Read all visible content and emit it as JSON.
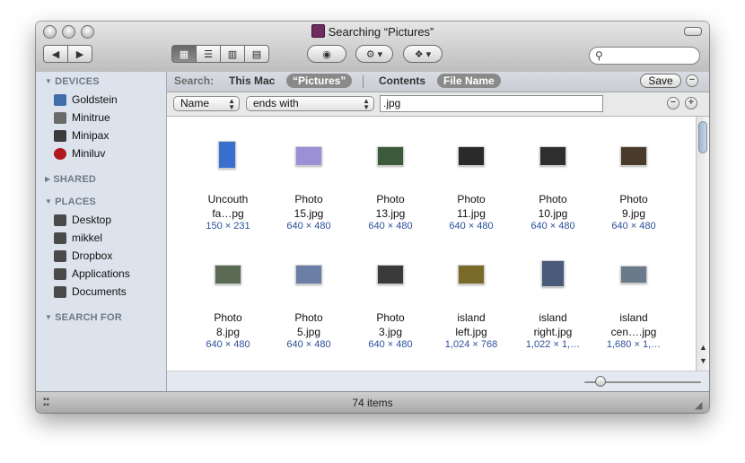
{
  "window": {
    "title": "Searching “Pictures”"
  },
  "toolbar": {
    "back_icon": "◀",
    "forward_icon": "▶",
    "view_icons": [
      "▦",
      "☰",
      "▥",
      "▤"
    ],
    "quicklook_icon": "◉",
    "action_icon": "⚙ ▾",
    "dropbox_icon": "❖ ▾",
    "search_placeholder": "",
    "search_icon": "⚲"
  },
  "sidebar": {
    "sections": {
      "devices": "DEVICES",
      "shared": "SHARED",
      "places": "PLACES",
      "search_for": "SEARCH FOR"
    },
    "devices": [
      {
        "label": "Goldstein",
        "color": "#3f6fa8"
      },
      {
        "label": "Minitrue",
        "color": "#6a6a6a"
      },
      {
        "label": "Minipax",
        "color": "#3b3b3b"
      },
      {
        "label": "Miniluv",
        "color": "#b0171f"
      }
    ],
    "places": [
      {
        "label": "Desktop"
      },
      {
        "label": "mikkel"
      },
      {
        "label": "Dropbox"
      },
      {
        "label": "Applications"
      },
      {
        "label": "Documents"
      }
    ]
  },
  "searchbar": {
    "label": "Search:",
    "this_mac": "This Mac",
    "pictures": "“Pictures”",
    "contents": "Contents",
    "file_name": "File Name",
    "save": "Save",
    "minus": "−"
  },
  "criteria": {
    "attribute": "Name",
    "operator": "ends with",
    "value": ".jpg",
    "minus": "−",
    "plus": "+"
  },
  "files": [
    {
      "name1": "Uncouth",
      "name2": "fa…pg",
      "dims": "150 × 231",
      "color": "#3a6fd0"
    },
    {
      "name1": "Photo",
      "name2": "15.jpg",
      "dims": "640 × 480",
      "color": "#9b8fd6"
    },
    {
      "name1": "Photo",
      "name2": "13.jpg",
      "dims": "640 × 480",
      "color": "#3c5a3a"
    },
    {
      "name1": "Photo",
      "name2": "11.jpg",
      "dims": "640 × 480",
      "color": "#2a2a2a"
    },
    {
      "name1": "Photo",
      "name2": "10.jpg",
      "dims": "640 × 480",
      "color": "#2e2e2e"
    },
    {
      "name1": "Photo",
      "name2": "9.jpg",
      "dims": "640 × 480",
      "color": "#4a3a2a"
    },
    {
      "name1": "Photo",
      "name2": "8.jpg",
      "dims": "640 × 480",
      "color": "#5a6a55"
    },
    {
      "name1": "Photo",
      "name2": "5.jpg",
      "dims": "640 × 480",
      "color": "#6a7ea6"
    },
    {
      "name1": "Photo",
      "name2": "3.jpg",
      "dims": "640 × 480",
      "color": "#3a3a3a"
    },
    {
      "name1": "island",
      "name2": "left.jpg",
      "dims": "1,024 × 768",
      "color": "#7a6a2a"
    },
    {
      "name1": "island",
      "name2": "right.jpg",
      "dims": "1,022 × 1,…",
      "color": "#4a5a7a"
    },
    {
      "name1": "island",
      "name2": "cen….jpg",
      "dims": "1,680 × 1,…",
      "color": "#6a7a8a"
    }
  ],
  "status": {
    "item_count": "74 items"
  }
}
